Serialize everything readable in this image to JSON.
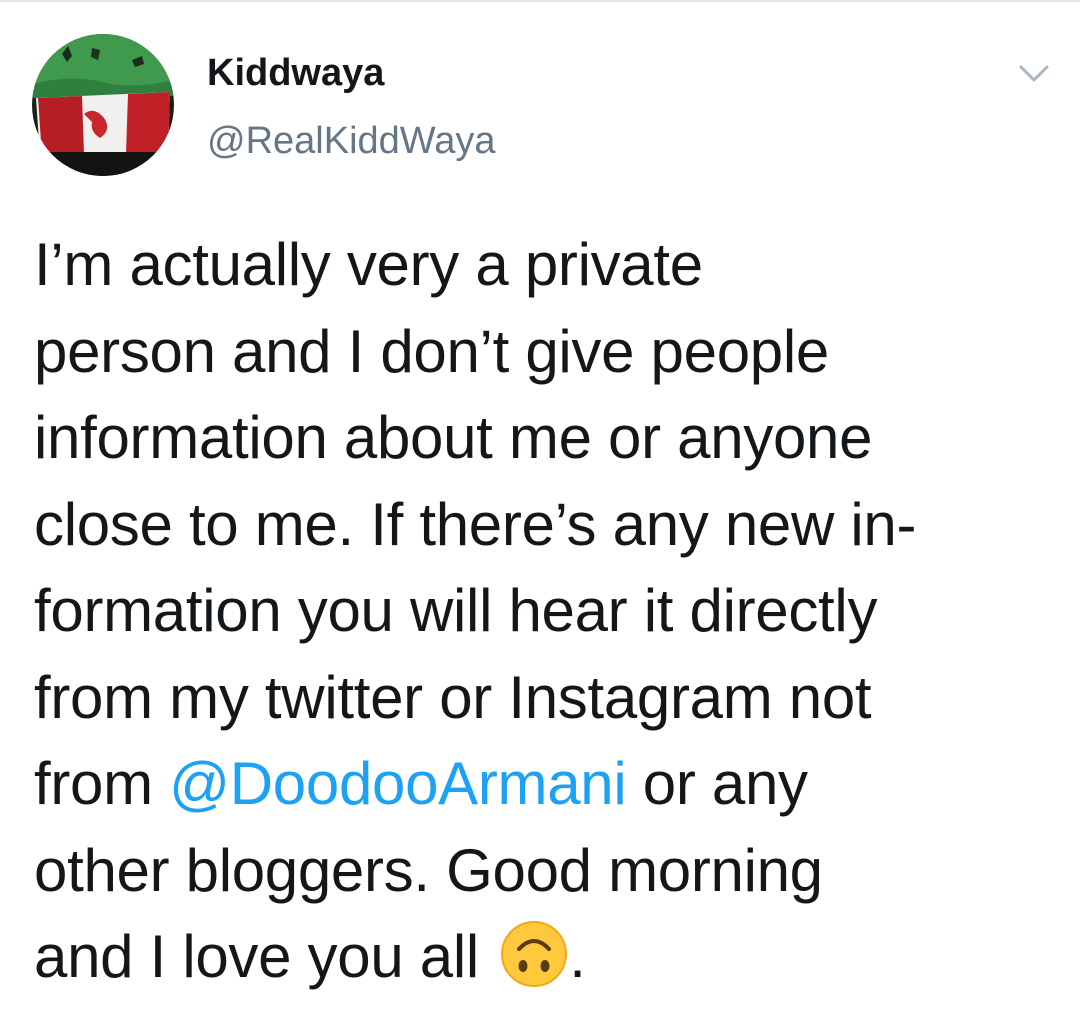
{
  "tweet": {
    "author": {
      "display_name": "Kiddwaya",
      "handle": "@RealKiddWaya",
      "avatar": "profile-photo"
    },
    "menu_icon": "chevron-down-icon",
    "lines": [
      "I’m actually very a private",
      "person and I don’t give people",
      "information about me or anyone",
      "close to me. If there’s any new in-",
      "formation you will hear it directly",
      "from my twitter or Instagram not"
    ],
    "line7_before": "from ",
    "mention": "@DoodooArmani",
    "line7_after": " or any",
    "line8": "other bloggers. Good morning",
    "line9_before": "and I love you all ",
    "line9_after": ".",
    "emoji": "upside-down-face-emoji"
  },
  "colors": {
    "text": "#14171a",
    "secondary": "#657786",
    "link": "#1da1f2",
    "divider": "#e1e8ed",
    "emoji": "#ffc83d"
  }
}
